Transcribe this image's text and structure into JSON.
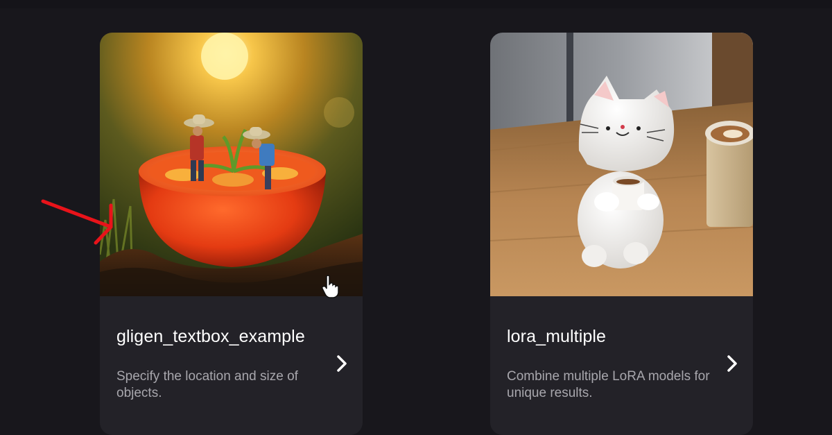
{
  "cards": [
    {
      "title": "gligen_textbox_example",
      "description": "Specify the location and size of objects.",
      "image_icon": "tomato-farmers-thumbnail"
    },
    {
      "title": "lora_multiple",
      "description": "Combine multiple LoRA models for unique results.",
      "image_icon": "ceramic-cat-coffee-thumbnail"
    }
  ],
  "overlays": {
    "annotation_color": "#e8131a",
    "cursor_icon": "hand-pointer-icon"
  }
}
